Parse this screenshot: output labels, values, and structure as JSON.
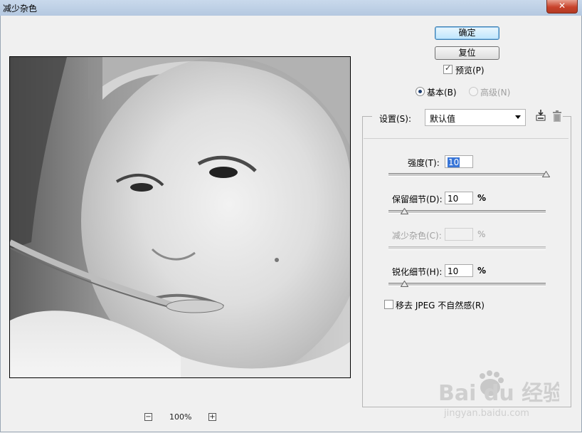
{
  "window": {
    "title": "减少杂色",
    "close_glyph": "✕"
  },
  "buttons": {
    "ok": "确定",
    "reset": "复位"
  },
  "preview_toggle": {
    "label": "预览(P)",
    "checked": true
  },
  "mode": {
    "basic": {
      "label": "基本(B)",
      "selected": true
    },
    "advanced": {
      "label": "高级(N)",
      "selected": false
    }
  },
  "settings": {
    "label": "设置(S):",
    "selected": "默认值",
    "save_icon": "save-settings-icon",
    "delete_icon": "trash-icon"
  },
  "controls": {
    "strength": {
      "label": "强度(T):",
      "value": "10",
      "level": 1.0
    },
    "preserve_details": {
      "label": "保留细节(D):",
      "value": "10",
      "unit": "%",
      "level": 0.1
    },
    "reduce_color_noise": {
      "label": "减少杂色(C):",
      "value": "",
      "unit": "%",
      "enabled": false
    },
    "sharpen_details": {
      "label": "锐化细节(H):",
      "value": "10",
      "unit": "%",
      "level": 0.1
    }
  },
  "jpeg_artifact": {
    "label": "移去 JPEG 不自然感(R)",
    "checked": false
  },
  "zoom": {
    "minus": "−",
    "plus": "+",
    "level": "100%"
  },
  "watermark": {
    "brand": "Bai du 经验",
    "url": "jingyan.baidu.com"
  }
}
